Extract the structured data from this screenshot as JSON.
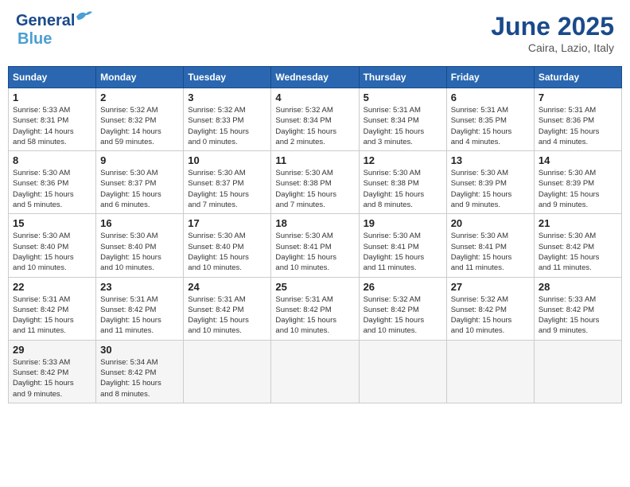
{
  "header": {
    "logo_line1": "General",
    "logo_line2": "Blue",
    "month": "June 2025",
    "location": "Caira, Lazio, Italy"
  },
  "weekdays": [
    "Sunday",
    "Monday",
    "Tuesday",
    "Wednesday",
    "Thursday",
    "Friday",
    "Saturday"
  ],
  "weeks": [
    [
      {
        "day": "1",
        "info": "Sunrise: 5:33 AM\nSunset: 8:31 PM\nDaylight: 14 hours\nand 58 minutes."
      },
      {
        "day": "2",
        "info": "Sunrise: 5:32 AM\nSunset: 8:32 PM\nDaylight: 14 hours\nand 59 minutes."
      },
      {
        "day": "3",
        "info": "Sunrise: 5:32 AM\nSunset: 8:33 PM\nDaylight: 15 hours\nand 0 minutes."
      },
      {
        "day": "4",
        "info": "Sunrise: 5:32 AM\nSunset: 8:34 PM\nDaylight: 15 hours\nand 2 minutes."
      },
      {
        "day": "5",
        "info": "Sunrise: 5:31 AM\nSunset: 8:34 PM\nDaylight: 15 hours\nand 3 minutes."
      },
      {
        "day": "6",
        "info": "Sunrise: 5:31 AM\nSunset: 8:35 PM\nDaylight: 15 hours\nand 4 minutes."
      },
      {
        "day": "7",
        "info": "Sunrise: 5:31 AM\nSunset: 8:36 PM\nDaylight: 15 hours\nand 4 minutes."
      }
    ],
    [
      {
        "day": "8",
        "info": "Sunrise: 5:30 AM\nSunset: 8:36 PM\nDaylight: 15 hours\nand 5 minutes."
      },
      {
        "day": "9",
        "info": "Sunrise: 5:30 AM\nSunset: 8:37 PM\nDaylight: 15 hours\nand 6 minutes."
      },
      {
        "day": "10",
        "info": "Sunrise: 5:30 AM\nSunset: 8:37 PM\nDaylight: 15 hours\nand 7 minutes."
      },
      {
        "day": "11",
        "info": "Sunrise: 5:30 AM\nSunset: 8:38 PM\nDaylight: 15 hours\nand 7 minutes."
      },
      {
        "day": "12",
        "info": "Sunrise: 5:30 AM\nSunset: 8:38 PM\nDaylight: 15 hours\nand 8 minutes."
      },
      {
        "day": "13",
        "info": "Sunrise: 5:30 AM\nSunset: 8:39 PM\nDaylight: 15 hours\nand 9 minutes."
      },
      {
        "day": "14",
        "info": "Sunrise: 5:30 AM\nSunset: 8:39 PM\nDaylight: 15 hours\nand 9 minutes."
      }
    ],
    [
      {
        "day": "15",
        "info": "Sunrise: 5:30 AM\nSunset: 8:40 PM\nDaylight: 15 hours\nand 10 minutes."
      },
      {
        "day": "16",
        "info": "Sunrise: 5:30 AM\nSunset: 8:40 PM\nDaylight: 15 hours\nand 10 minutes."
      },
      {
        "day": "17",
        "info": "Sunrise: 5:30 AM\nSunset: 8:40 PM\nDaylight: 15 hours\nand 10 minutes."
      },
      {
        "day": "18",
        "info": "Sunrise: 5:30 AM\nSunset: 8:41 PM\nDaylight: 15 hours\nand 10 minutes."
      },
      {
        "day": "19",
        "info": "Sunrise: 5:30 AM\nSunset: 8:41 PM\nDaylight: 15 hours\nand 11 minutes."
      },
      {
        "day": "20",
        "info": "Sunrise: 5:30 AM\nSunset: 8:41 PM\nDaylight: 15 hours\nand 11 minutes."
      },
      {
        "day": "21",
        "info": "Sunrise: 5:30 AM\nSunset: 8:42 PM\nDaylight: 15 hours\nand 11 minutes."
      }
    ],
    [
      {
        "day": "22",
        "info": "Sunrise: 5:31 AM\nSunset: 8:42 PM\nDaylight: 15 hours\nand 11 minutes."
      },
      {
        "day": "23",
        "info": "Sunrise: 5:31 AM\nSunset: 8:42 PM\nDaylight: 15 hours\nand 11 minutes."
      },
      {
        "day": "24",
        "info": "Sunrise: 5:31 AM\nSunset: 8:42 PM\nDaylight: 15 hours\nand 10 minutes."
      },
      {
        "day": "25",
        "info": "Sunrise: 5:31 AM\nSunset: 8:42 PM\nDaylight: 15 hours\nand 10 minutes."
      },
      {
        "day": "26",
        "info": "Sunrise: 5:32 AM\nSunset: 8:42 PM\nDaylight: 15 hours\nand 10 minutes."
      },
      {
        "day": "27",
        "info": "Sunrise: 5:32 AM\nSunset: 8:42 PM\nDaylight: 15 hours\nand 10 minutes."
      },
      {
        "day": "28",
        "info": "Sunrise: 5:33 AM\nSunset: 8:42 PM\nDaylight: 15 hours\nand 9 minutes."
      }
    ],
    [
      {
        "day": "29",
        "info": "Sunrise: 5:33 AM\nSunset: 8:42 PM\nDaylight: 15 hours\nand 9 minutes."
      },
      {
        "day": "30",
        "info": "Sunrise: 5:34 AM\nSunset: 8:42 PM\nDaylight: 15 hours\nand 8 minutes."
      },
      {
        "day": "",
        "info": ""
      },
      {
        "day": "",
        "info": ""
      },
      {
        "day": "",
        "info": ""
      },
      {
        "day": "",
        "info": ""
      },
      {
        "day": "",
        "info": ""
      }
    ]
  ]
}
